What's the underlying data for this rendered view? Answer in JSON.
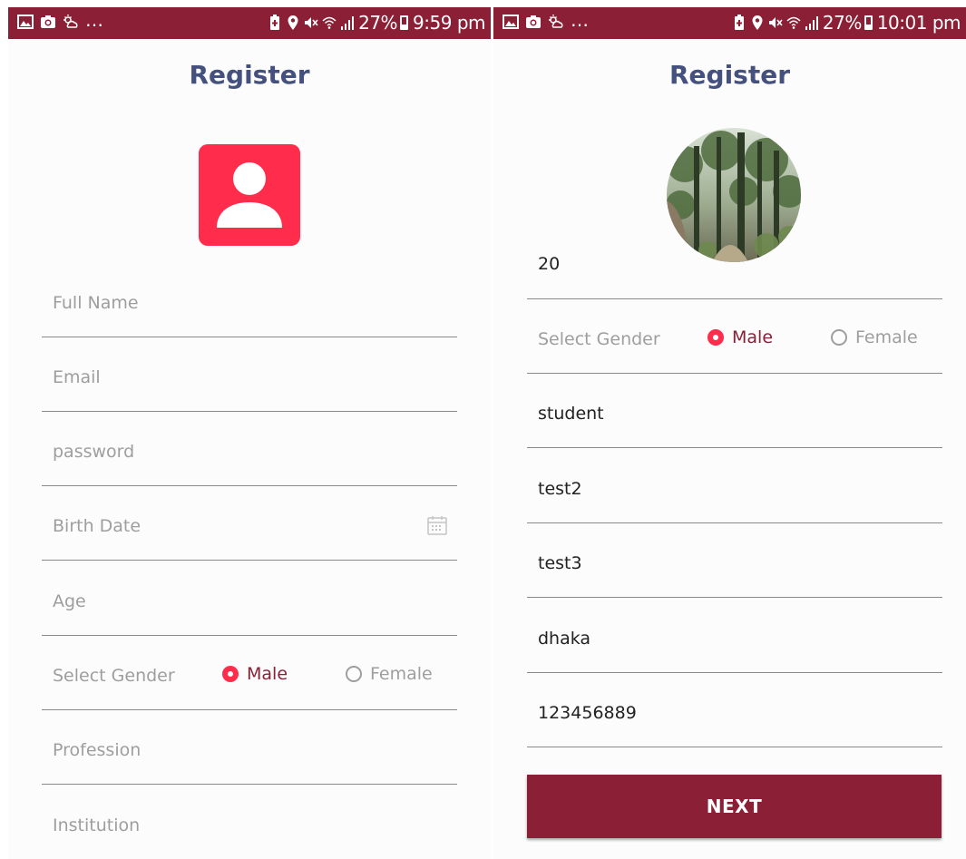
{
  "left": {
    "status": {
      "battery": "27%",
      "time": "9:59 pm"
    },
    "title": "Register",
    "fields": {
      "full_name": "Full Name",
      "email": "Email",
      "password": "password",
      "birth_date": "Birth Date",
      "age": "Age",
      "gender_label": "Select Gender",
      "profession": "Profession",
      "institution": "Institution"
    },
    "gender": {
      "male": "Male",
      "female": "Female",
      "selected": "Male"
    }
  },
  "right": {
    "status": {
      "battery": "27%",
      "time": "10:01 pm"
    },
    "title": "Register",
    "age_value": "20",
    "gender_label": "Select Gender",
    "gender": {
      "male": "Male",
      "female": "Female",
      "selected": "Male"
    },
    "values": {
      "profession": "student",
      "institution": "test2",
      "field3": "test3",
      "address": "dhaka",
      "phone": "123456889"
    },
    "next_label": "NEXT"
  },
  "colors": {
    "statusbar": "#8a1f36",
    "title": "#44507e",
    "accent": "#ff2d4b",
    "button": "#8a1f36"
  }
}
